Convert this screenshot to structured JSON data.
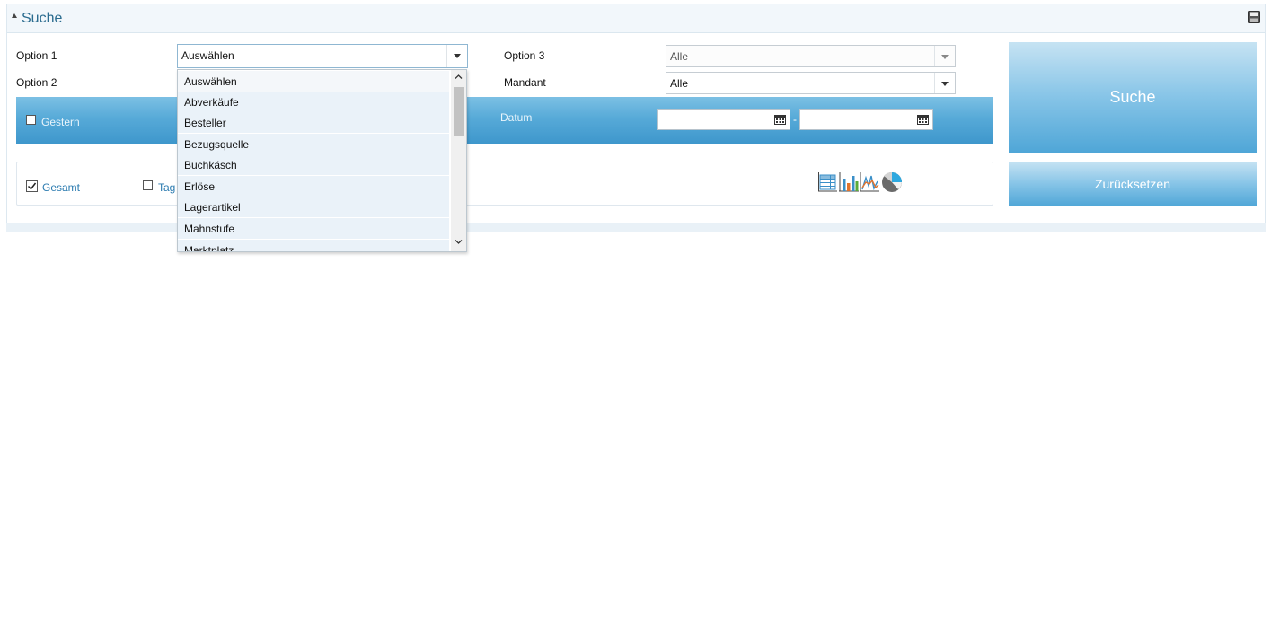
{
  "panel": {
    "title": "Suche"
  },
  "filters": {
    "option1": {
      "label": "Option 1",
      "value": "Auswählen"
    },
    "option2": {
      "label": "Option 2"
    },
    "option3": {
      "label": "Option 3",
      "value": "Alle"
    },
    "mandant": {
      "label": "Mandant",
      "value": "Alle"
    }
  },
  "period": {
    "gestern_label": "Gestern",
    "datum_label": "Datum",
    "date_from": "",
    "date_to": "",
    "separator": "-"
  },
  "grouping": {
    "gesamt_label": "Gesamt",
    "gesamt_checked": true,
    "tag_label": "Tag",
    "tag_checked": false
  },
  "buttons": {
    "search": "Suche",
    "reset": "Zurücksetzen"
  },
  "dropdown": {
    "items": [
      "Auswählen",
      "Abverkäufe",
      "Besteller",
      "Bezugsquelle",
      "Buchkäsch",
      "Erlöse",
      "Lagerartikel",
      "Mahnstufe",
      "Marktplatz"
    ]
  },
  "icons": [
    "collapse-triangle-icon",
    "save-disk-icon",
    "calendar-icon",
    "table-view-icon",
    "bar-chart-icon",
    "line-chart-icon",
    "pie-chart-icon",
    "checkbox-checked-icon"
  ],
  "colors": {
    "accent": "#57aad8",
    "title": "#2b6c8f",
    "label_link": "#2b7bb0"
  }
}
